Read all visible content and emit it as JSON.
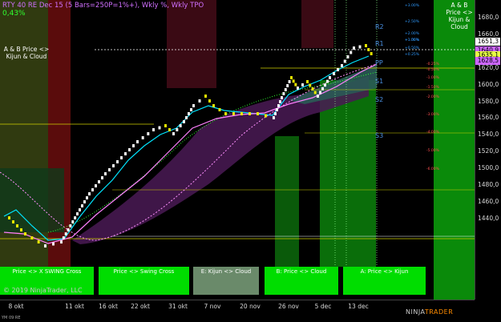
{
  "header": {
    "instrument_title": "RTY 40 RE Dec 15 (5 Bars=250P=1%+), Wkly %, Wkly TPO",
    "change_pct": "0,43%"
  },
  "annotations": {
    "left_box": "A & B Price <> Kijun & Cloud",
    "right_box": "A & B Price <> Kijun & Cloud",
    "copyright": "© 2019 NinjaTrader, LLC"
  },
  "status_bars": [
    {
      "label": "Price <> X SWING Cross",
      "color": "#00dd00"
    },
    {
      "label": "Price <> Swing Cross",
      "color": "#00dd00"
    },
    {
      "label": "E: Kijun <> Cloud",
      "color": "#6a8a6a"
    },
    {
      "label": "B: Price <> Cloud",
      "color": "#00dd00"
    },
    {
      "label": "A: Price <> Kijun",
      "color": "#00dd00"
    }
  ],
  "pivots": {
    "r2": "R2",
    "r1": "R1",
    "pp": "PP",
    "s1": "S1",
    "s2": "S2",
    "s3": "S3"
  },
  "weekly_pct_levels": [
    "+3.00%",
    "+2.50%",
    "+2.00%",
    "+1.50%",
    "+1.00%",
    "+0.50%",
    "+0.25%",
    "-0.25%",
    "-0.50%",
    "-1.00%",
    "-1.50%",
    "-2.00%",
    "-3.00%",
    "-4.00%",
    "-5.00%",
    "-6.00%"
  ],
  "y_axis": {
    "ticks": [
      "1680,0",
      "1660,0",
      "1640,0",
      "1620,0",
      "1600,0",
      "1580,0",
      "1560,0",
      "1540,0",
      "1520,0",
      "1500,0",
      "1480,0",
      "1460,0",
      "1440,0"
    ],
    "price_tags": [
      {
        "label": "1651,3",
        "bg": "#ffffff",
        "fg": "#000000"
      },
      {
        "label": "1640,9",
        "bg": "#cc66ff",
        "fg": "#000000"
      },
      {
        "label": "1635,1",
        "bg": "#e8ff44",
        "fg": "#000000"
      },
      {
        "label": "1628,5",
        "bg": "#cc66ff",
        "fg": "#000000"
      }
    ]
  },
  "x_axis": {
    "ticks": [
      "8 okt",
      "11 okt",
      "16 okt",
      "22 okt",
      "31 okt",
      "7 nov",
      "20 nov",
      "26 nov",
      "5 dec",
      "13 dec"
    ]
  },
  "footer": {
    "symbol_tag": "YM 09 RE",
    "brand_a": "NINJA",
    "brand_b": "TRADER"
  },
  "colors": {
    "renko_up": "#ffffff",
    "kijun": "#ff80ff",
    "tenkan": "#00e5ff",
    "cloud": "#552266",
    "green_zone": "#0a7a0a",
    "red_zone": "#5a0a0a"
  }
}
